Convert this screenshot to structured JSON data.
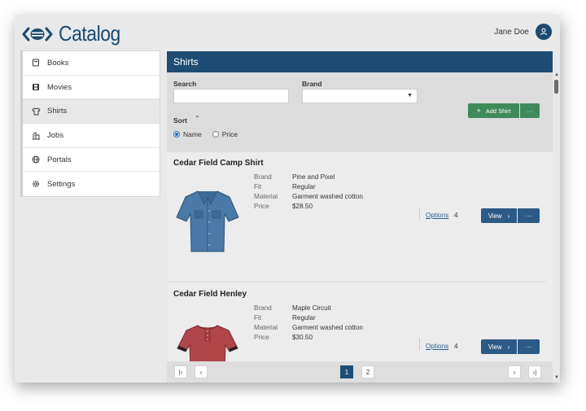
{
  "app": {
    "title": "Catalog",
    "user_name": "Jane Doe"
  },
  "sidebar": {
    "items": [
      {
        "label": "Books",
        "icon": "book-icon"
      },
      {
        "label": "Movies",
        "icon": "film-icon"
      },
      {
        "label": "Shirts",
        "icon": "shirt-icon",
        "active": true
      },
      {
        "label": "Jobs",
        "icon": "jobs-icon"
      },
      {
        "label": "Portals",
        "icon": "globe-icon"
      },
      {
        "label": "Settings",
        "icon": "gear-icon"
      }
    ]
  },
  "main": {
    "title": "Shirts",
    "filters": {
      "search_label": "Search",
      "search_value": "",
      "brand_label": "Brand",
      "brand_value": "",
      "sort_label": "Sort",
      "sort_options": [
        "Name",
        "Price"
      ],
      "sort_selected": "Name",
      "add_button": "Add Shirt",
      "more_button": "···"
    },
    "products": [
      {
        "name": "Cedar Field Camp Shirt",
        "attr_labels": [
          "Brand",
          "Fit",
          "Material",
          "Price"
        ],
        "attr_values": [
          "Pine and Pixel",
          "Regular",
          "Garment washed cotton",
          "$28.50"
        ],
        "options_label": "Options",
        "options_count": "4",
        "view_label": "View",
        "color": "#4a79a8"
      },
      {
        "name": "Cedar Field Henley",
        "attr_labels": [
          "Brand",
          "Fit",
          "Material",
          "Price"
        ],
        "attr_values": [
          "Maple Circuit",
          "Regular",
          "Garment washed cotton",
          "$30.50"
        ],
        "options_label": "Options",
        "options_count": "4",
        "view_label": "View",
        "color": "#b0454a"
      }
    ],
    "pagination": {
      "pages": [
        "1",
        "2"
      ],
      "current": "1"
    }
  },
  "colors": {
    "brand": "#1d4d74",
    "accent_green": "#3f8a5a",
    "button_blue": "#2b5a86"
  }
}
